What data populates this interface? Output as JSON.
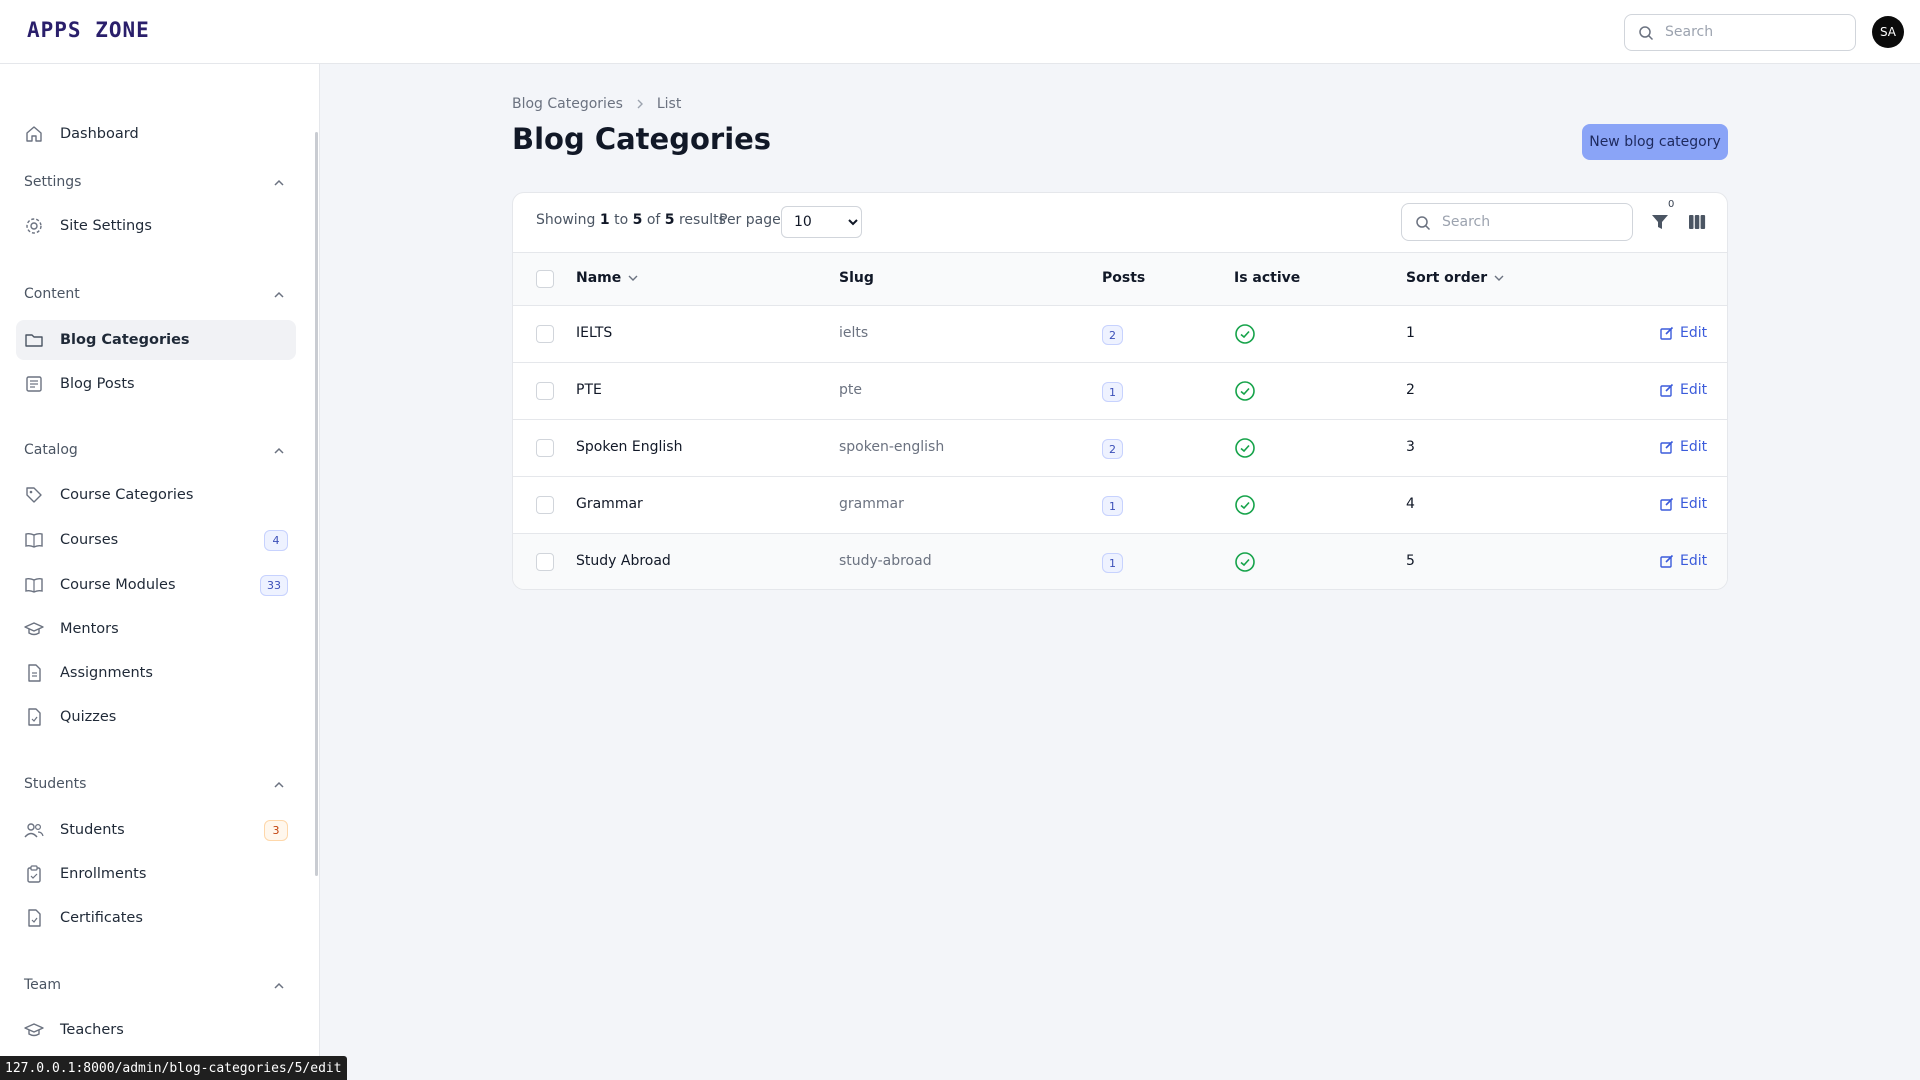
{
  "app": {
    "logo_text": "APPS ZONE",
    "search_placeholder": "Search",
    "avatar_initials": "SA"
  },
  "sidebar": {
    "dashboard": {
      "label": "Dashboard",
      "icon": "home-icon"
    },
    "groups": [
      {
        "label": "Settings",
        "items": [
          {
            "label": "Site Settings",
            "icon": "gear-icon"
          }
        ]
      },
      {
        "label": "Content",
        "items": [
          {
            "label": "Blog Categories",
            "icon": "folder-icon",
            "active": true
          },
          {
            "label": "Blog Posts",
            "icon": "newspaper-icon"
          }
        ]
      },
      {
        "label": "Catalog",
        "items": [
          {
            "label": "Course Categories",
            "icon": "tag-icon"
          },
          {
            "label": "Courses",
            "icon": "book-icon",
            "badge": "4"
          },
          {
            "label": "Course Modules",
            "icon": "book-open-icon",
            "badge": "33"
          },
          {
            "label": "Mentors",
            "icon": "graduation-cap-icon"
          },
          {
            "label": "Assignments",
            "icon": "document-icon"
          },
          {
            "label": "Quizzes",
            "icon": "document-check-icon"
          }
        ]
      },
      {
        "label": "Students",
        "items": [
          {
            "label": "Students",
            "icon": "users-icon",
            "badge": "3"
          },
          {
            "label": "Enrollments",
            "icon": "clipboard-icon"
          },
          {
            "label": "Certificates",
            "icon": "certificate-icon"
          }
        ]
      },
      {
        "label": "Team",
        "items": [
          {
            "label": "Teachers",
            "icon": "graduation-cap-icon"
          }
        ]
      }
    ]
  },
  "statusbar_url": "127.0.0.1:8000/admin/blog-categories/5/edit",
  "breadcrumb": {
    "parent": "Blog Categories",
    "current": "List"
  },
  "page_title": "Blog Categories",
  "new_button": "New blog category",
  "table": {
    "showing": {
      "prefix": "Showing",
      "from": "1",
      "to_word": "to",
      "to": "5",
      "of_word": "of",
      "total": "5",
      "suffix": "results"
    },
    "per_page_label": "Per page",
    "per_page_value": "10",
    "search_placeholder": "Search",
    "filter_count": "0",
    "columns": {
      "name": "Name",
      "slug": "Slug",
      "posts": "Posts",
      "is_active": "Is active",
      "sort_order": "Sort order"
    },
    "edit_label": "Edit",
    "rows": [
      {
        "name": "IELTS",
        "slug": "ielts",
        "posts": "2",
        "is_active": true,
        "sort_order": "1"
      },
      {
        "name": "PTE",
        "slug": "pte",
        "posts": "1",
        "is_active": true,
        "sort_order": "2"
      },
      {
        "name": "Spoken English",
        "slug": "spoken-english",
        "posts": "2",
        "is_active": true,
        "sort_order": "3"
      },
      {
        "name": "Grammar",
        "slug": "grammar",
        "posts": "1",
        "is_active": true,
        "sort_order": "4"
      },
      {
        "name": "Study Abroad",
        "slug": "study-abroad",
        "posts": "1",
        "is_active": true,
        "sort_order": "5"
      }
    ]
  },
  "colors": {
    "accent": "#8aa4f7",
    "link": "#3b5bdb",
    "success": "#16a34a",
    "background": "#f3f5f9"
  }
}
